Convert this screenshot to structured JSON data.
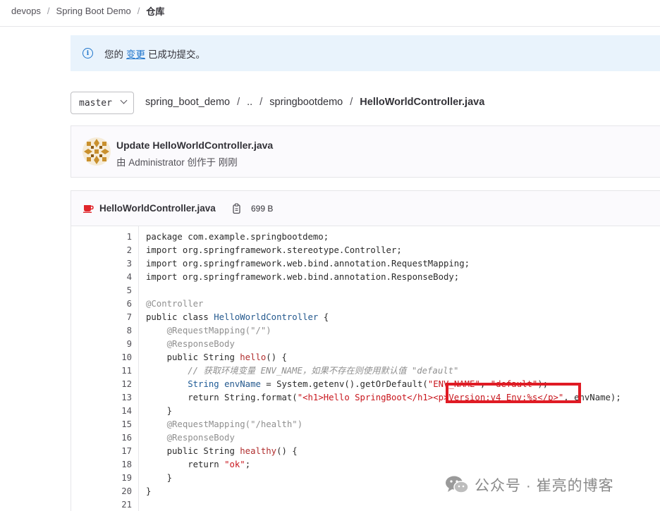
{
  "breadcrumb": [
    "devops",
    "Spring Boot Demo",
    "仓库"
  ],
  "alert": {
    "prefix": "您的",
    "link": "变更",
    "suffix": "已成功提交。"
  },
  "branch": "master",
  "path": [
    "spring_boot_demo",
    "..",
    "springbootdemo",
    "HelloWorldController.java"
  ],
  "commit": {
    "title": "Update HelloWorldController.java",
    "meta": "由 Administrator 创作于 刚刚"
  },
  "file": {
    "name": "HelloWorldController.java",
    "size": "699 B"
  },
  "code": {
    "line_numbers": [
      "1",
      "2",
      "3",
      "4",
      "5",
      "6",
      "7",
      "8",
      "9",
      "10",
      "11",
      "12",
      "13",
      "14",
      "15",
      "16",
      "17",
      "18",
      "19",
      "20",
      "21"
    ],
    "lines": [
      [
        {
          "t": "package com.example.springbootdemo;",
          "c": ""
        }
      ],
      [
        {
          "t": "import org.springframework.stereotype.Controller;",
          "c": ""
        }
      ],
      [
        {
          "t": "import org.springframework.web.bind.annotation.RequestMapping;",
          "c": ""
        }
      ],
      [
        {
          "t": "import org.springframework.web.bind.annotation.ResponseBody;",
          "c": ""
        }
      ],
      [],
      [
        {
          "t": "@Controller",
          "c": "ann"
        }
      ],
      [
        {
          "t": "public class ",
          "c": ""
        },
        {
          "t": "HelloWorldController",
          "c": "cls"
        },
        {
          "t": " {",
          "c": ""
        }
      ],
      [
        {
          "t": "    ",
          "c": ""
        },
        {
          "t": "@RequestMapping(\"/\")",
          "c": "ann"
        }
      ],
      [
        {
          "t": "    ",
          "c": ""
        },
        {
          "t": "@ResponseBody",
          "c": "ann"
        }
      ],
      [
        {
          "t": "    public String ",
          "c": ""
        },
        {
          "t": "hello",
          "c": "fn"
        },
        {
          "t": "() {",
          "c": ""
        }
      ],
      [
        {
          "t": "        ",
          "c": ""
        },
        {
          "t": "// 获取环境变量 ENV_NAME，如果不存在则使用默认值 \"default\"",
          "c": "com"
        }
      ],
      [
        {
          "t": "        ",
          "c": ""
        },
        {
          "t": "String",
          "c": "type"
        },
        {
          "t": " ",
          "c": ""
        },
        {
          "t": "envName",
          "c": "cls"
        },
        {
          "t": " = System.getenv().getOrDefault(",
          "c": ""
        },
        {
          "t": "\"ENV_NAME\"",
          "c": "str"
        },
        {
          "t": ", ",
          "c": ""
        },
        {
          "t": "\"default\"",
          "c": "str"
        },
        {
          "t": ");",
          "c": ""
        }
      ],
      [
        {
          "t": "        return String.format(",
          "c": ""
        },
        {
          "t": "\"<h1>Hello SpringBoot</h1><p>Version:v4 Env:%s</p>\"",
          "c": "str"
        },
        {
          "t": ", envName);",
          "c": ""
        }
      ],
      [
        {
          "t": "    }",
          "c": ""
        }
      ],
      [
        {
          "t": "    ",
          "c": ""
        },
        {
          "t": "@RequestMapping(\"/health\")",
          "c": "ann"
        }
      ],
      [
        {
          "t": "    ",
          "c": ""
        },
        {
          "t": "@ResponseBody",
          "c": "ann"
        }
      ],
      [
        {
          "t": "    public String ",
          "c": ""
        },
        {
          "t": "healthy",
          "c": "fn"
        },
        {
          "t": "() {",
          "c": ""
        }
      ],
      [
        {
          "t": "        return ",
          "c": ""
        },
        {
          "t": "\"ok\"",
          "c": "str"
        },
        {
          "t": ";",
          "c": ""
        }
      ],
      [
        {
          "t": "    }",
          "c": ""
        }
      ],
      [
        {
          "t": "}",
          "c": ""
        }
      ],
      []
    ]
  },
  "watermark": "公众号 · 崔亮的博客",
  "colors": {
    "accent": "#1f75cb",
    "alert_bg": "#e9f3fc",
    "highlight": "#e01b24",
    "string": "#c8161d"
  }
}
